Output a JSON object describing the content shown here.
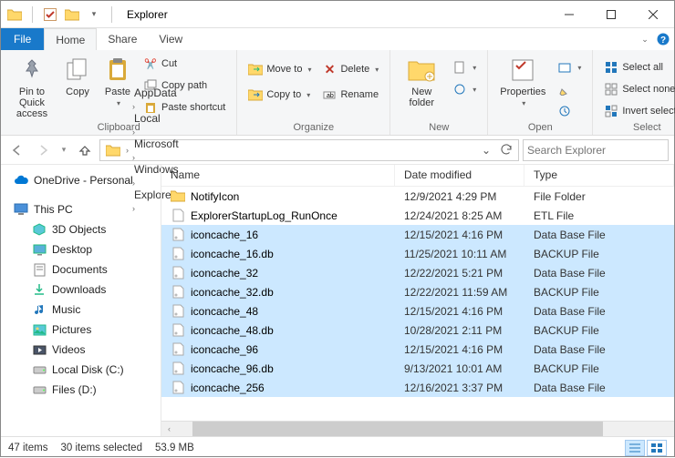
{
  "title": "Explorer",
  "tabs": {
    "file": "File",
    "home": "Home",
    "share": "Share",
    "view": "View"
  },
  "ribbon": {
    "clipboard": {
      "label": "Clipboard",
      "pin": "Pin to Quick\naccess",
      "copy": "Copy",
      "paste": "Paste",
      "cut": "Cut",
      "copy_path": "Copy path",
      "paste_shortcut": "Paste shortcut"
    },
    "organize": {
      "label": "Organize",
      "move_to": "Move to",
      "copy_to": "Copy to",
      "delete": "Delete",
      "rename": "Rename"
    },
    "new": {
      "label": "New",
      "new_folder": "New\nfolder"
    },
    "open": {
      "label": "Open",
      "properties": "Properties"
    },
    "select": {
      "label": "Select",
      "select_all": "Select all",
      "select_none": "Select none",
      "invert": "Invert selection"
    }
  },
  "breadcrumbs": [
    "AppData",
    "Local",
    "Microsoft",
    "Windows",
    "Explorer"
  ],
  "search_placeholder": "Search Explorer",
  "nav": [
    {
      "label": "OneDrive - Personal",
      "icon": "cloud",
      "indent": false
    },
    {
      "label": "This PC",
      "icon": "pc",
      "indent": false
    },
    {
      "label": "3D Objects",
      "icon": "3d",
      "indent": true
    },
    {
      "label": "Desktop",
      "icon": "desktop",
      "indent": true
    },
    {
      "label": "Documents",
      "icon": "docs",
      "indent": true
    },
    {
      "label": "Downloads",
      "icon": "downloads",
      "indent": true
    },
    {
      "label": "Music",
      "icon": "music",
      "indent": true
    },
    {
      "label": "Pictures",
      "icon": "pictures",
      "indent": true
    },
    {
      "label": "Videos",
      "icon": "videos",
      "indent": true
    },
    {
      "label": "Local Disk (C:)",
      "icon": "disk",
      "indent": true
    },
    {
      "label": "Files (D:)",
      "icon": "disk",
      "indent": true
    }
  ],
  "columns": {
    "name": "Name",
    "date": "Date modified",
    "type": "Type"
  },
  "files": [
    {
      "name": "NotifyIcon",
      "date": "12/9/2021 4:29 PM",
      "type": "File Folder",
      "icon": "folder",
      "selected": false
    },
    {
      "name": "ExplorerStartupLog_RunOnce",
      "date": "12/24/2021 8:25 AM",
      "type": "ETL File",
      "icon": "file",
      "selected": false
    },
    {
      "name": "iconcache_16",
      "date": "12/15/2021 4:16 PM",
      "type": "Data Base File",
      "icon": "db",
      "selected": true
    },
    {
      "name": "iconcache_16.db",
      "date": "11/25/2021 10:11 AM",
      "type": "BACKUP File",
      "icon": "db",
      "selected": true
    },
    {
      "name": "iconcache_32",
      "date": "12/22/2021 5:21 PM",
      "type": "Data Base File",
      "icon": "db",
      "selected": true
    },
    {
      "name": "iconcache_32.db",
      "date": "12/22/2021 11:59 AM",
      "type": "BACKUP File",
      "icon": "db",
      "selected": true
    },
    {
      "name": "iconcache_48",
      "date": "12/15/2021 4:16 PM",
      "type": "Data Base File",
      "icon": "db",
      "selected": true
    },
    {
      "name": "iconcache_48.db",
      "date": "10/28/2021 2:11 PM",
      "type": "BACKUP File",
      "icon": "db",
      "selected": true
    },
    {
      "name": "iconcache_96",
      "date": "12/15/2021 4:16 PM",
      "type": "Data Base File",
      "icon": "db",
      "selected": true
    },
    {
      "name": "iconcache_96.db",
      "date": "9/13/2021 10:01 AM",
      "type": "BACKUP File",
      "icon": "db",
      "selected": true
    },
    {
      "name": "iconcache_256",
      "date": "12/16/2021 3:37 PM",
      "type": "Data Base File",
      "icon": "db",
      "selected": true
    }
  ],
  "status": {
    "count": "47 items",
    "selected": "30 items selected",
    "size": "53.9 MB"
  }
}
